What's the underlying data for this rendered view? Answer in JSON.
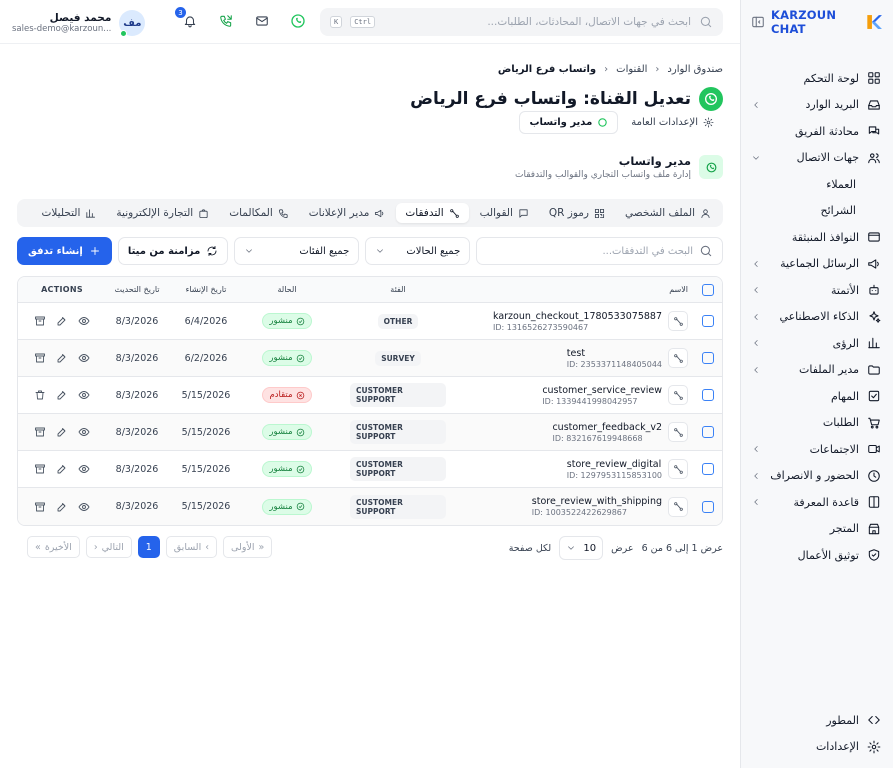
{
  "brand": {
    "name": "KARZOUN CHAT"
  },
  "topbar": {
    "search_placeholder": "ابحث في جهات الاتصال، المحادثات، الطلبات...",
    "kbd_ctrl": "Ctrl",
    "kbd_k": "K",
    "notifications_count": "3",
    "user_name": "محمد فيصل",
    "user_email": "sales-demo@karzoun...",
    "avatar_initials": "مف"
  },
  "sidebar": {
    "items": [
      {
        "label": "لوحة التحكم",
        "icon": "dashboard-icon",
        "chevron": false
      },
      {
        "label": "البريد الوارد",
        "icon": "inbox-icon",
        "chevron": true
      },
      {
        "label": "محادثة الفريق",
        "icon": "team-chat-icon",
        "chevron": false
      },
      {
        "label": "جهات الاتصال",
        "icon": "contacts-icon",
        "chevron": true,
        "expanded": true
      },
      {
        "label": "العملاء",
        "sub": true
      },
      {
        "label": "الشرائح",
        "sub": true
      },
      {
        "label": "النوافذ المنبثقة",
        "icon": "popup-icon",
        "chevron": false
      },
      {
        "label": "الرسائل الجماعية",
        "icon": "megaphone-icon",
        "chevron": true
      },
      {
        "label": "الأتمتة",
        "icon": "bot-icon",
        "chevron": true
      },
      {
        "label": "الذكاء الاصطناعي",
        "icon": "sparkles-icon",
        "chevron": true
      },
      {
        "label": "الرؤى",
        "icon": "bar-chart-icon",
        "chevron": true
      },
      {
        "label": "مدير الملفات",
        "icon": "folder-icon",
        "chevron": true
      },
      {
        "label": "المهام",
        "icon": "task-icon",
        "chevron": false
      },
      {
        "label": "الطلبات",
        "icon": "cart-icon",
        "chevron": false
      },
      {
        "label": "الاجتماعات",
        "icon": "video-icon",
        "chevron": true
      },
      {
        "label": "الحضور و الانصراف",
        "icon": "clock-icon",
        "chevron": true
      },
      {
        "label": "قاعدة المعرفة",
        "icon": "book-icon",
        "chevron": true
      },
      {
        "label": "المتجر",
        "icon": "store-icon",
        "chevron": false
      },
      {
        "label": "توثيق الأعمال",
        "icon": "shield-check-icon",
        "chevron": false
      }
    ],
    "bottom": [
      {
        "label": "المطور",
        "icon": "code-icon"
      },
      {
        "label": "الإعدادات",
        "icon": "gear-icon"
      }
    ]
  },
  "breadcrumb": [
    "صندوق الوارد",
    "القنوات",
    "واتساب فرع الرياض"
  ],
  "page": {
    "title": "تعديل القناة: واتساب فرع الرياض",
    "subtabs": [
      {
        "label": "الإعدادات العامة",
        "icon": "gear-icon",
        "active": false
      },
      {
        "label": "مدير واتساب",
        "icon": "whatsapp-icon",
        "active": true
      }
    ],
    "section_title": "مدير واتساب",
    "section_desc": "إدارة ملف واتساب التجاري والقوالب والتدفقات"
  },
  "tabs": [
    {
      "label": "الملف الشخصي",
      "icon": "user-icon",
      "active": false
    },
    {
      "label": "رموز QR",
      "icon": "qr-icon",
      "active": false
    },
    {
      "label": "القوالب",
      "icon": "message-icon",
      "active": false
    },
    {
      "label": "التدفقات",
      "icon": "flow-icon",
      "active": true
    },
    {
      "label": "مدير الإعلانات",
      "icon": "megaphone-icon",
      "active": false
    },
    {
      "label": "المكالمات",
      "icon": "phone-icon",
      "active": false
    },
    {
      "label": "التجارة الإلكترونية",
      "icon": "bag-icon",
      "active": false
    },
    {
      "label": "التحليلات",
      "icon": "bar-chart-icon",
      "active": false
    }
  ],
  "filters": {
    "search_placeholder": "البحث في التدفقات...",
    "status": "جميع الحالات",
    "category": "جميع الفئات",
    "sync_label": "مزامنة من ميتا",
    "create_label": "إنشاء تدفق"
  },
  "table": {
    "headers": {
      "name": "الاسم",
      "category": "الفئة",
      "status": "الحالة",
      "created": "تاريخ الإنشاء",
      "updated": "تاريخ التحديث",
      "actions": "ACTIONS"
    },
    "rows": [
      {
        "name": "karzoun_checkout_1780533075887",
        "id": "ID: 1316526273590467",
        "category": "OTHER",
        "status": "منشور",
        "status_type": "published",
        "created": "6/4/2026",
        "updated": "8/3/2026"
      },
      {
        "name": "test",
        "id": "ID: 2353371148405044",
        "category": "SURVEY",
        "status": "منشور",
        "status_type": "published",
        "created": "6/2/2026",
        "updated": "8/3/2026"
      },
      {
        "name": "customer_service_review",
        "id": "ID: 1339441998042957",
        "category": "CUSTOMER SUPPORT",
        "status": "متقادم",
        "status_type": "deprecated",
        "created": "5/15/2026",
        "updated": "8/3/2026"
      },
      {
        "name": "customer_feedback_v2",
        "id": "ID: 832167619948668",
        "category": "CUSTOMER SUPPORT",
        "status": "منشور",
        "status_type": "published",
        "created": "5/15/2026",
        "updated": "8/3/2026"
      },
      {
        "name": "store_review_digital",
        "id": "ID: 1297953115853100",
        "category": "CUSTOMER SUPPORT",
        "status": "منشور",
        "status_type": "published",
        "created": "5/15/2026",
        "updated": "8/3/2026"
      },
      {
        "name": "store_review_with_shipping",
        "id": "ID: 1003522422629867",
        "category": "CUSTOMER SUPPORT",
        "status": "منشور",
        "status_type": "published",
        "created": "5/15/2026",
        "updated": "8/3/2026"
      }
    ]
  },
  "pagination": {
    "info": "عرض 1 إلى 6 من 6",
    "show_label": "عرض",
    "per_page": "10",
    "per_page_suffix": "لكل صفحة",
    "first": "الأولى",
    "prev": "السابق",
    "current": "1",
    "next": "التالي",
    "last": "الأخيرة"
  },
  "colors": {
    "primary": "#2563eb",
    "whatsapp": "#22c55e",
    "published": "#15803d",
    "deprecated": "#b91c1c"
  }
}
